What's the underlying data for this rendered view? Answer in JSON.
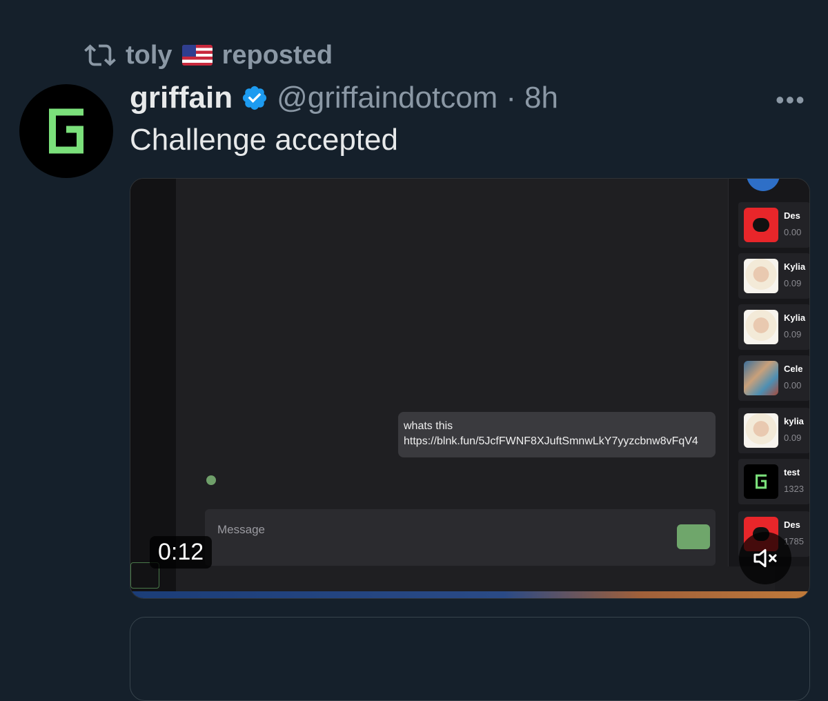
{
  "repost": {
    "user": "toly",
    "flag": "🇺🇸",
    "label": "reposted"
  },
  "tweet": {
    "author": "griffain",
    "handle": "@griffaindotcom",
    "separator": "·",
    "time": "8h",
    "text": "Challenge accepted",
    "more": "•••"
  },
  "video": {
    "timer": "0:12",
    "chat_message_line1": "whats this",
    "chat_message_line2": "https://blnk.fun/5JcfFWNF8XJuftSmnwLkY7yyzcbnw8vFqV4",
    "input_placeholder": "Message",
    "panel_items": [
      {
        "name": "Des",
        "value": "0.00",
        "thumb": "cat-red"
      },
      {
        "name": "Kylia",
        "value": "0.09",
        "thumb": "doll"
      },
      {
        "name": "Kylia",
        "value": "0.09",
        "thumb": "doll"
      },
      {
        "name": "Cele",
        "value": "0.00",
        "thumb": "art"
      },
      {
        "name": "kylia",
        "value": "0.09",
        "thumb": "doll"
      },
      {
        "name": "test",
        "value": "1323",
        "thumb": "g-logo"
      },
      {
        "name": "Des",
        "value": "1785",
        "thumb": "cat-red"
      }
    ]
  },
  "colors": {
    "background": "#15202b",
    "verified": "#1d9bf0",
    "logo_green": "#7be07b"
  }
}
